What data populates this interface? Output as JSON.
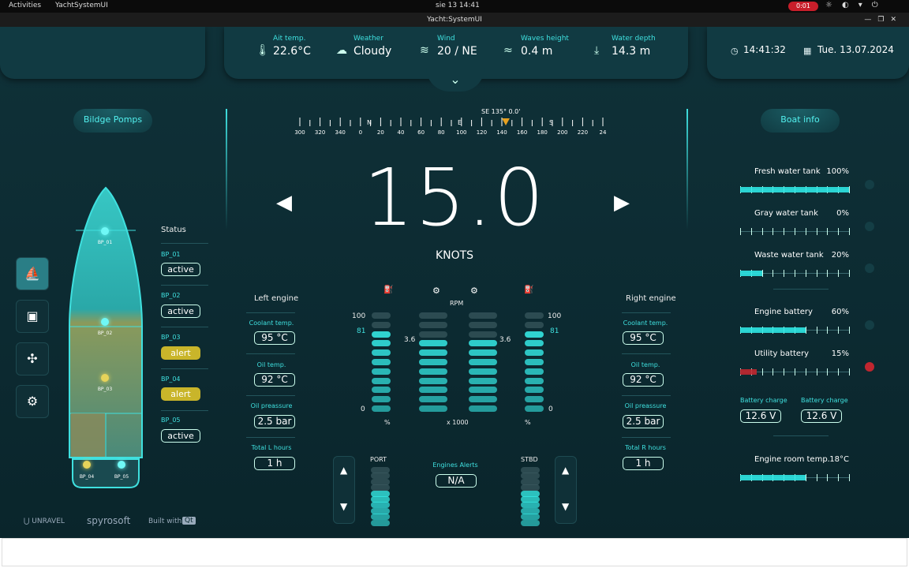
{
  "os": {
    "activities": "Activities",
    "app_name": "YachtSystemUI",
    "clock": "sie 13  14:41",
    "rec_time": "0:01"
  },
  "window": {
    "title": "Yacht:SystemUI"
  },
  "weather": [
    {
      "label": "Ait temp.",
      "value": "22.6°C",
      "icon": "thermometer-icon"
    },
    {
      "label": "Weather",
      "value": "Cloudy",
      "icon": "cloud-icon"
    },
    {
      "label": "Wind",
      "value": "20 / NE",
      "icon": "wind-icon"
    },
    {
      "label": "Waves height",
      "value": "0.4 m",
      "icon": "waves-icon"
    },
    {
      "label": "Water depth",
      "value": "14.3 m",
      "icon": "anchor-depth-icon"
    }
  ],
  "clock": {
    "time": "14:41:32",
    "date": "Tue. 13.07.2024"
  },
  "left": {
    "title": "Bildge Pomps",
    "status_label": "Status",
    "pumps": [
      {
        "id": "BP_01",
        "status": "active"
      },
      {
        "id": "BP_02",
        "status": "active"
      },
      {
        "id": "BP_03",
        "status": "alert"
      },
      {
        "id": "BP_04",
        "status": "alert"
      },
      {
        "id": "BP_05",
        "status": "active"
      }
    ],
    "hull_labels": [
      "BP_01",
      "BP_02",
      "BP_03",
      "BP_04",
      "BP_05"
    ]
  },
  "compass": {
    "heading": "SE 135° 0.0'",
    "letters": [
      "N",
      "E",
      "S"
    ],
    "ticks": [
      "300",
      "320",
      "340",
      "0",
      "20",
      "40",
      "60",
      "80",
      "100",
      "120",
      "140",
      "160",
      "180",
      "200",
      "220",
      "24"
    ]
  },
  "speed": {
    "value": "15.0",
    "unit": "KNOTS"
  },
  "left_engine": {
    "title": "Left engine",
    "coolant_label": "Coolant temp.",
    "coolant": "95 °C",
    "oil_label": "Oil temp.",
    "oil": "92 °C",
    "press_label": "Oil preassure",
    "press": "2.5 bar",
    "hours_label": "Total L hours",
    "hours": "1 h"
  },
  "right_engine": {
    "title": "Right engine",
    "coolant_label": "Coolant temp.",
    "coolant": "95 °C",
    "oil_label": "Oil temp.",
    "oil": "92 °C",
    "press_label": "Oil preassure",
    "press": "2.5 bar",
    "hours_label": "Total R hours",
    "hours": "1 h"
  },
  "gauges": {
    "rpm_label": "RPM",
    "rpm_unit": "x 1000",
    "rpm_left": "3.6",
    "rpm_right": "3.6",
    "fuel_max": "100",
    "fuel_min": "0",
    "fuel_left": "81",
    "fuel_right": "81",
    "pct": "%",
    "fuel_left_level": 0.81,
    "fuel_right_level": 0.81,
    "rpm_left_level": 0.75,
    "rpm_right_level": 0.75
  },
  "trim": {
    "port": "PORT",
    "stbd": "STBD",
    "alerts_label": "Engines Alerts",
    "alerts_value": "N/A",
    "port_level": 0.6,
    "stbd_level": 0.6
  },
  "boat": {
    "title": "Boat info",
    "tanks": [
      {
        "label": "Fresh water tank",
        "value": "100%",
        "level": 1.0,
        "color": "#2ee6e3"
      },
      {
        "label": "Gray water tank",
        "value": "0%",
        "level": 0.0,
        "color": "#2ee6e3"
      },
      {
        "label": "Waste water tank",
        "value": "20%",
        "level": 0.2,
        "color": "#2ee6e3"
      },
      {
        "label": "Engine battery",
        "value": "60%",
        "level": 0.6,
        "color": "#2ee6e3"
      },
      {
        "label": "Utility battery",
        "value": "15%",
        "level": 0.15,
        "color": "#c0262f"
      }
    ],
    "charge_label_1": "Battery charge",
    "charge_value_1": "12.6 V",
    "charge_label_2": "Battery charge",
    "charge_value_2": "12.6 V",
    "room_label": "Engine room temp.",
    "room_value": "18°C",
    "room_level": 0.6
  },
  "footer": {
    "brand1": "UNRAVEL",
    "brand2": "spyrosoft",
    "built": "Built with",
    "qt": "Qt"
  }
}
